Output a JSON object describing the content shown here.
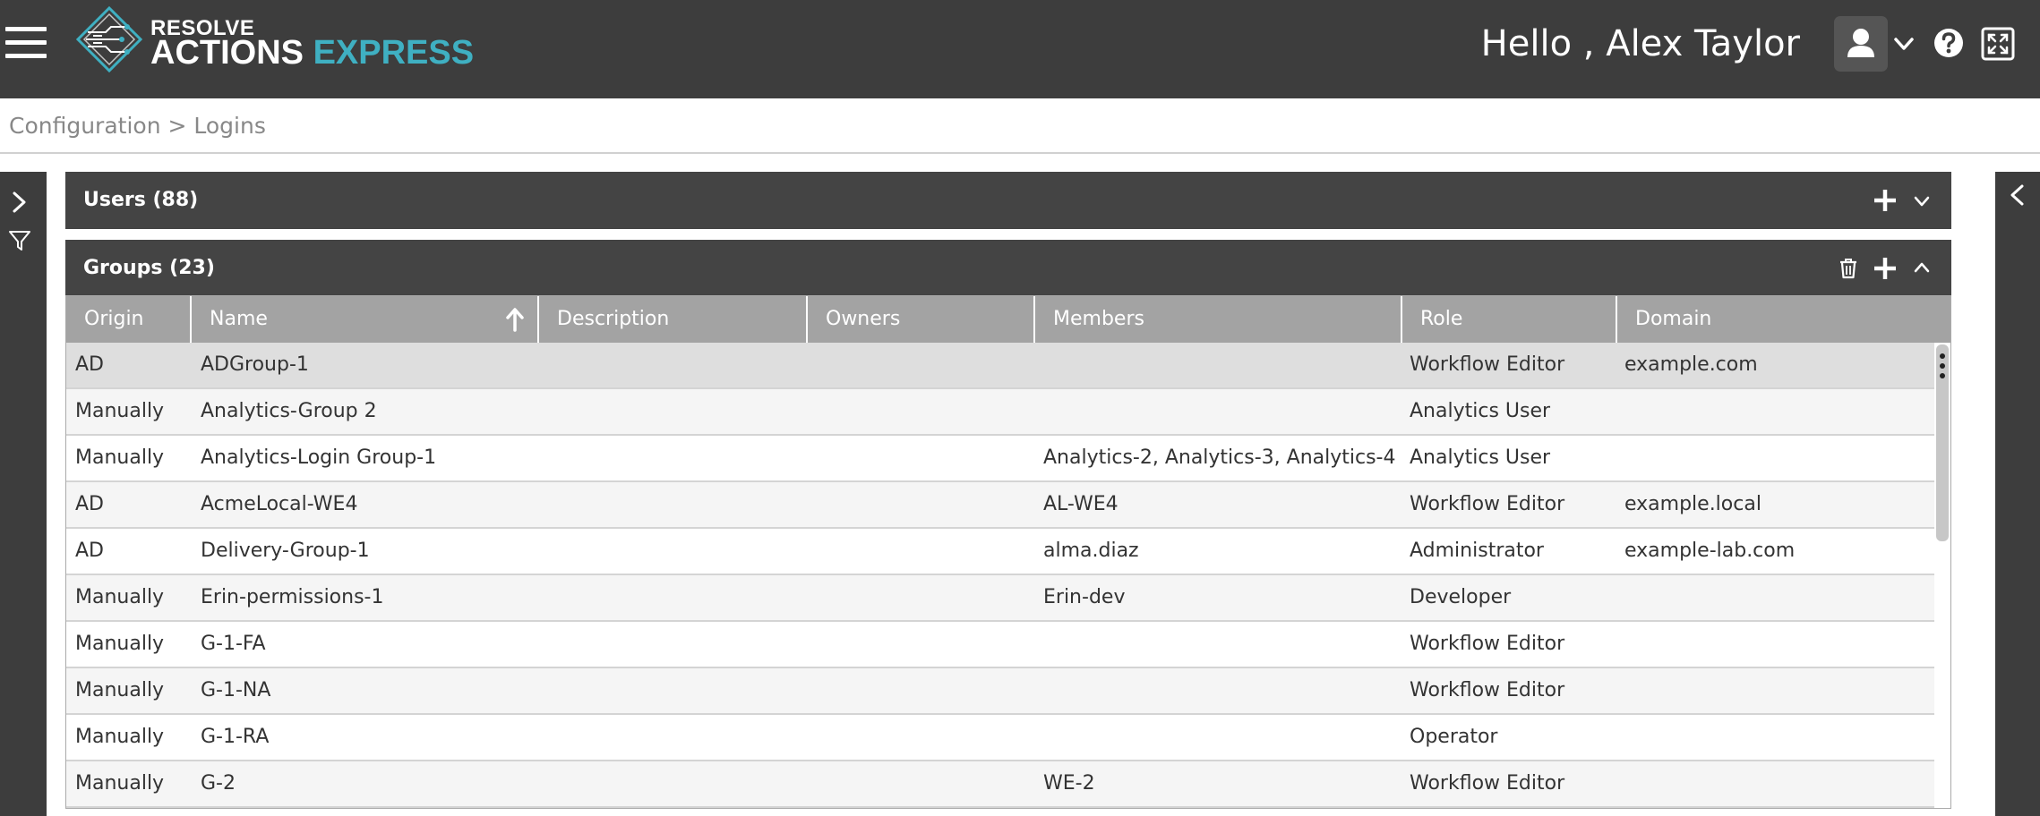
{
  "app": {
    "logo_top": "RESOLVE",
    "logo_word1": "ACTIONS",
    "logo_word2": "EXPRESS",
    "greeting": "Hello , Alex Taylor",
    "accent_color": "#3fb0c2"
  },
  "icons": {
    "menu": "hamburger-icon",
    "user": "user-icon",
    "caret": "chevron-down-icon",
    "help": "help-icon",
    "fullscreen": "expand-icon",
    "expand_left": "chevron-right-icon",
    "filter": "filter-icon",
    "collapse_right": "chevron-left-icon",
    "add": "plus-icon",
    "delete": "trash-icon",
    "collapse": "chevron-up-icon",
    "sort": "sort-asc-icon"
  },
  "breadcrumb": "Configuration > Logins",
  "users_panel": {
    "title": "Users (88)"
  },
  "groups_panel": {
    "title": "Groups (23)"
  },
  "table": {
    "columns": [
      "Origin",
      "Name",
      "Description",
      "Owners",
      "Members",
      "Role",
      "Domain"
    ],
    "sorted_column": "Name",
    "sort_direction": "ascending",
    "rows": [
      {
        "origin": "AD",
        "name": "ADGroup-1",
        "description": "",
        "owners": "",
        "members": "",
        "role": "Workflow Editor",
        "domain": "example.com"
      },
      {
        "origin": "Manually",
        "name": "Analytics-Group 2",
        "description": "",
        "owners": "",
        "members": "",
        "role": "Analytics User",
        "domain": ""
      },
      {
        "origin": "Manually",
        "name": "Analytics-Login Group-1",
        "description": "",
        "owners": "",
        "members": "Analytics-2, Analytics-3, Analytics-4",
        "role": "Analytics User",
        "domain": ""
      },
      {
        "origin": "AD",
        "name": "AcmeLocal-WE4",
        "description": "",
        "owners": "",
        "members": "AL-WE4",
        "role": "Workflow Editor",
        "domain": "example.local"
      },
      {
        "origin": "AD",
        "name": "Delivery-Group-1",
        "description": "",
        "owners": "",
        "members": "alma.diaz",
        "role": "Administrator",
        "domain": "example-lab.com"
      },
      {
        "origin": "Manually",
        "name": "Erin-permissions-1",
        "description": "",
        "owners": "",
        "members": "Erin-dev",
        "role": "Developer",
        "domain": ""
      },
      {
        "origin": "Manually",
        "name": "G-1-FA",
        "description": "",
        "owners": "",
        "members": "",
        "role": "Workflow Editor",
        "domain": ""
      },
      {
        "origin": "Manually",
        "name": "G-1-NA",
        "description": "",
        "owners": "",
        "members": "",
        "role": "Workflow Editor",
        "domain": ""
      },
      {
        "origin": "Manually",
        "name": "G-1-RA",
        "description": "",
        "owners": "",
        "members": "",
        "role": "Operator",
        "domain": ""
      },
      {
        "origin": "Manually",
        "name": "G-2",
        "description": "",
        "owners": "",
        "members": "WE-2",
        "role": "Workflow Editor",
        "domain": ""
      }
    ]
  }
}
